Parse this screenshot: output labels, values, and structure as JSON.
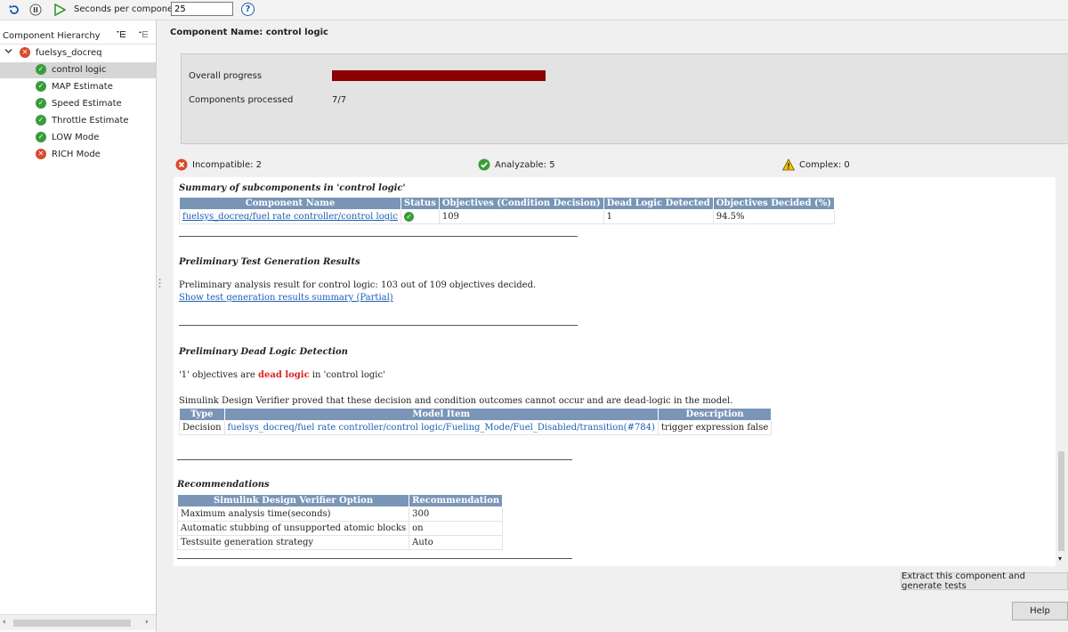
{
  "toolbar": {
    "seconds_label": "Seconds per component",
    "seconds_value": "25",
    "help_glyph": "?"
  },
  "sidebar": {
    "title": "Component Hierarchy",
    "root": {
      "label": "fuelsys_docreq",
      "status": "error"
    },
    "items": [
      {
        "label": "control logic",
        "status": "ok",
        "selected": true
      },
      {
        "label": "MAP Estimate",
        "status": "ok"
      },
      {
        "label": "Speed Estimate",
        "status": "ok"
      },
      {
        "label": "Throttle Estimate",
        "status": "ok"
      },
      {
        "label": "LOW Mode",
        "status": "ok"
      },
      {
        "label": "RICH Mode",
        "status": "error"
      }
    ]
  },
  "main": {
    "component_name": "Component Name: control logic",
    "overall_progress_label": "Overall progress",
    "overall_progress_fraction": 1.0,
    "progress_color": "#8b0000",
    "components_processed_label": "Components processed",
    "components_processed_value": "7/7",
    "incompatible": "Incompatible: 2",
    "analyzable": "Analyzable: 5",
    "complex": "Complex: 0"
  },
  "report": {
    "summary_title": "Summary of subcomponents in 'control logic'",
    "summary_headers": [
      "Component Name",
      "Status",
      "Objectives (Condition Decision)",
      "Dead Logic Detected",
      "Objectives Decided (%)"
    ],
    "summary_row": {
      "name": "fuelsys_docreq/fuel rate controller/control logic",
      "objectives": "109",
      "dead_logic": "1",
      "decided": "94.5%"
    },
    "test_gen_title": "Preliminary Test Generation Results",
    "test_gen_text": "Preliminary analysis result for control logic: 103 out of 109 objectives decided.",
    "test_gen_link": "Show test generation results summary (Partial)",
    "dead_logic_title": "Preliminary Dead Logic Detection",
    "dead_prefix": "'1' objectives are ",
    "dead_word": "dead logic",
    "dead_suffix": " in 'control logic'",
    "proof_text": "Simulink Design Verifier proved that these decision and condition outcomes cannot occur and are dead-logic in the model.",
    "dead_headers": [
      "Type",
      "Model Item",
      "Description"
    ],
    "dead_row": {
      "type": "Decision",
      "item": "fuelsys_docreq/fuel rate controller/control logic/Fueling_Mode/Fuel_Disabled/transition(#784)",
      "description": "trigger expression false"
    },
    "rec_title": "Recommendations",
    "rec_headers": [
      "Simulink Design Verifier Option",
      "Recommendation"
    ],
    "rec_rows": [
      {
        "option": "Maximum analysis time(seconds)",
        "value": "300"
      },
      {
        "option": "Automatic stubbing of unsupported atomic blocks",
        "value": "on"
      },
      {
        "option": "Testsuite generation strategy",
        "value": "Auto"
      }
    ]
  },
  "buttons": {
    "extract": "Extract this component and generate tests",
    "help": "Help"
  }
}
